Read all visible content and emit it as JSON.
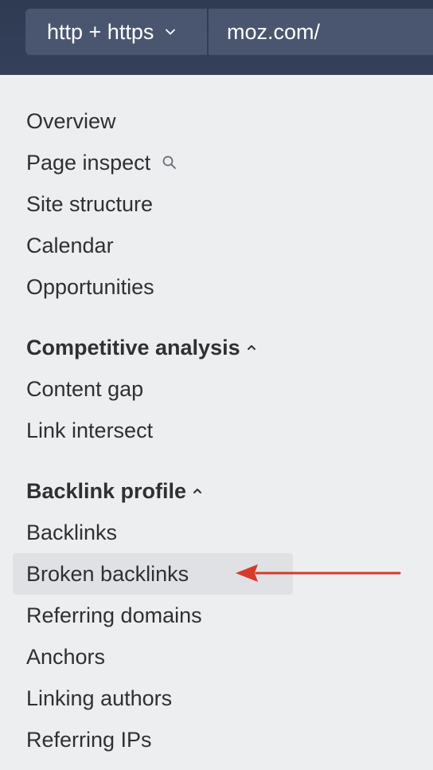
{
  "header": {
    "protocol_label": "http + https",
    "url_value": "moz.com/"
  },
  "nav": {
    "main_items": [
      "Overview",
      "Page inspect",
      "Site structure",
      "Calendar",
      "Opportunities"
    ],
    "competitive": {
      "title": "Competitive analysis",
      "items": [
        "Content gap",
        "Link intersect"
      ]
    },
    "backlink": {
      "title": "Backlink profile",
      "items": [
        "Backlinks",
        "Broken backlinks",
        "Referring domains",
        "Anchors",
        "Linking authors",
        "Referring IPs"
      ]
    },
    "selected_item": "Broken backlinks"
  },
  "colors": {
    "topbar": "#2f3b52",
    "control": "#4a5670",
    "highlight": "#dfe1e5",
    "arrow": "#d63a2a",
    "text": "#2f3033"
  },
  "icons": {
    "protocol_dropdown": "chevron-down-icon",
    "page_inspect": "search-icon",
    "section_toggle": "chevron-up-icon",
    "annotation": "arrow-left-icon"
  }
}
